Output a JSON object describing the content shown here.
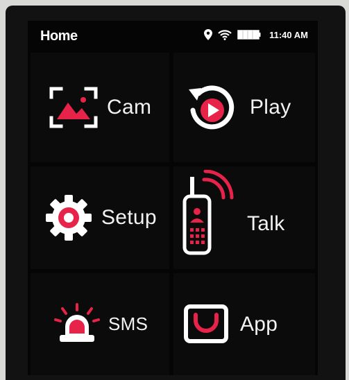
{
  "statusbar": {
    "title": "Home",
    "time": "11:40 AM",
    "icons": [
      "location-pin-icon",
      "wifi-icon",
      "battery-icon"
    ]
  },
  "tiles": [
    {
      "label": "Cam",
      "icon": "camera-focus-icon"
    },
    {
      "label": "Play",
      "icon": "replay-icon"
    },
    {
      "label": "Setup",
      "icon": "gear-icon"
    },
    {
      "label": "Talk",
      "icon": "walkie-talkie-icon"
    },
    {
      "label": "SMS",
      "icon": "alarm-light-icon"
    },
    {
      "label": "App",
      "icon": "app-cup-icon"
    }
  ],
  "colors": {
    "accent": "#e8234a",
    "text": "#f2f2f2",
    "screen": "#050505",
    "tile": "#0b0b0b"
  }
}
